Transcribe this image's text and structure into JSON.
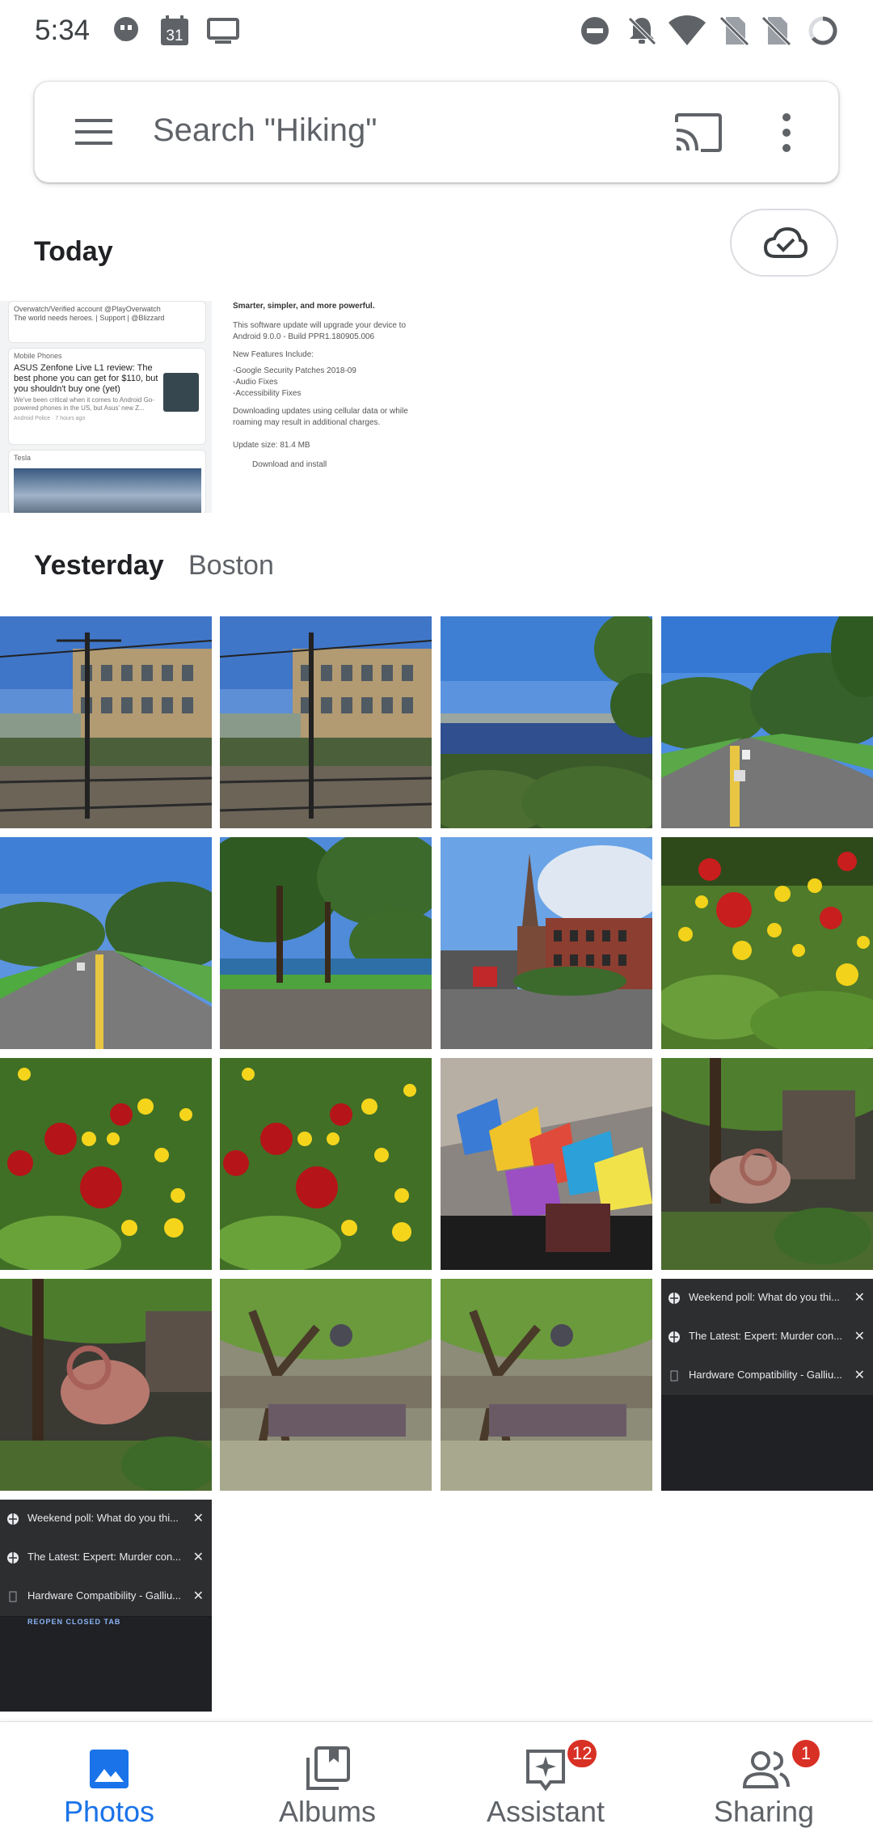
{
  "status_bar": {
    "time": "5:34",
    "calendar_day": "31"
  },
  "search": {
    "placeholder": "Search \"Hiking\""
  },
  "sections": {
    "today": {
      "label": "Today"
    },
    "yesterday": {
      "label": "Yesterday",
      "location": "Boston"
    }
  },
  "today_screenshots": {
    "feed": {
      "top_line": "Overwatch/Verified account @PlayOverwatch",
      "top_line2": "The world needs heroes. | Support | @Blizzard",
      "card1_source": "Mobile Phones",
      "card1_title": "ASUS Zenfone Live L1 review: The best phone you can get for $110, but you shouldn't buy one (yet)",
      "card1_body": "We've been critical when it comes to Android Go-powered phones in the US, but Asus' new Z...",
      "card1_meta": "Android Police · 7 hours ago",
      "card2_source": "Tesla"
    },
    "update": {
      "heading": "Smarter, simpler, and more powerful.",
      "line1": "This software update will upgrade your device to Android 9.0.0 - Build PPR1.180905.006",
      "features_label": "New Features Include:",
      "f1": "-Google Security Patches 2018-09",
      "f2": "-Audio Fixes",
      "f3": "-Accessibility Fixes",
      "note": "Downloading updates using cellular data or while roaming may result in additional charges.",
      "size": "Update size: 81.4 MB",
      "action": "Download and install"
    }
  },
  "tabs_tile": {
    "rows": [
      "Weekend poll: What do you thi...",
      "The Latest: Expert: Murder con...",
      "Hardware Compatibility - Galliu..."
    ],
    "close_glyph": "✕",
    "reopen": "REOPEN CLOSED TAB"
  },
  "bottom_nav": {
    "items": [
      {
        "label": "Photos"
      },
      {
        "label": "Albums"
      },
      {
        "label": "Assistant",
        "badge": "12"
      },
      {
        "label": "Sharing",
        "badge": "1"
      }
    ]
  },
  "colors": {
    "accent": "#1a73e8",
    "badge": "#d93025"
  }
}
